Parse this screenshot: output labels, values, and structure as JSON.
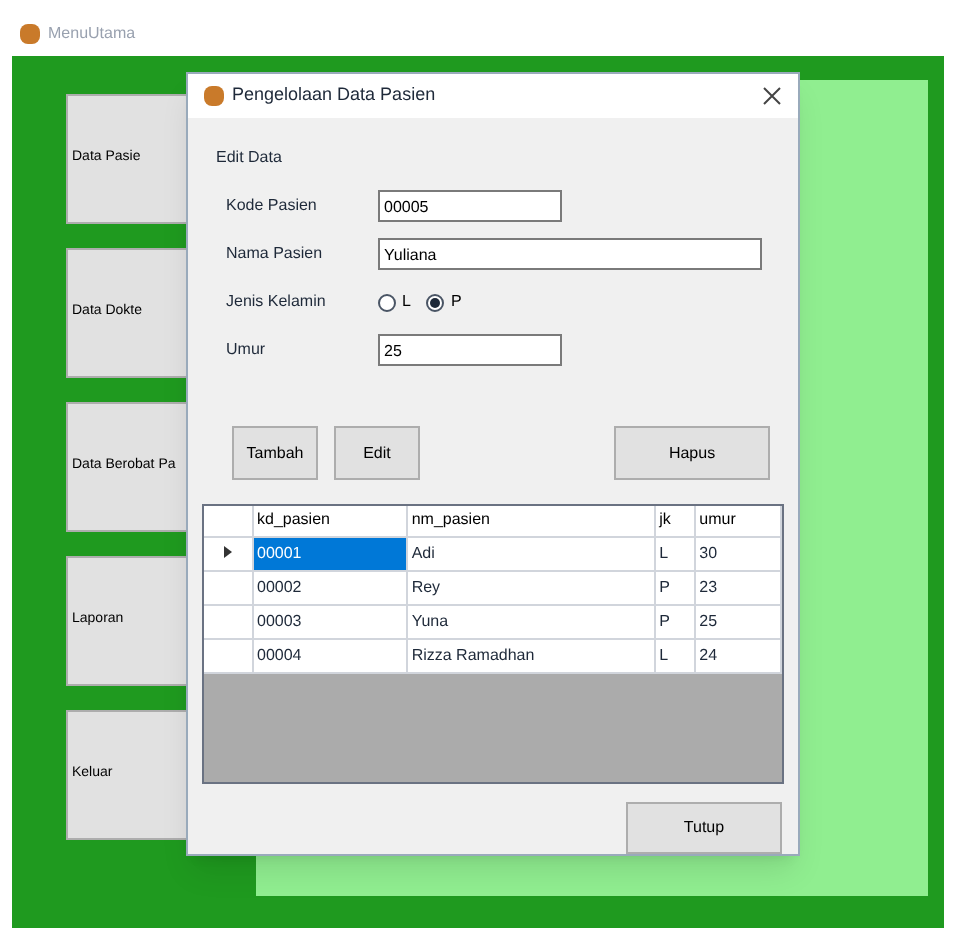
{
  "main_window": {
    "title": "MenuUtama"
  },
  "menu_buttons": [
    "Data Pasie",
    "Data Dokte",
    "Data Berobat Pa",
    "Laporan",
    "Keluar"
  ],
  "dialog": {
    "title": "Pengelolaan Data Pasien",
    "group": "Edit Data",
    "fields": [
      {
        "label": "Kode Pasien",
        "value": "00005",
        "kind": "short"
      },
      {
        "label": "Nama Pasien",
        "value": "Yuliana",
        "kind": "long"
      },
      {
        "label": "Jenis Kelamin",
        "kind": "radio",
        "options": [
          {
            "label": "L",
            "selected": false
          },
          {
            "label": "P",
            "selected": true
          }
        ]
      },
      {
        "label": "Umur",
        "value": "25",
        "kind": "short"
      }
    ],
    "buttons": [
      "Tambah",
      "Edit",
      "Hapus"
    ],
    "table": {
      "columns": [
        "kd_pasien",
        "nm_pasien",
        "jk",
        "umur"
      ],
      "rows": [
        {
          "cells": [
            "00001",
            "Adi",
            "L",
            "30"
          ],
          "selected": true
        },
        {
          "cells": [
            "00002",
            "Rey",
            "P",
            "23"
          ],
          "selected": false
        },
        {
          "cells": [
            "00003",
            "Yuna",
            "P",
            "25"
          ],
          "selected": false
        },
        {
          "cells": [
            "00004",
            "Rizza Ramadhan",
            "L",
            "24"
          ],
          "selected": false
        }
      ]
    },
    "close_button": "Tutup"
  }
}
